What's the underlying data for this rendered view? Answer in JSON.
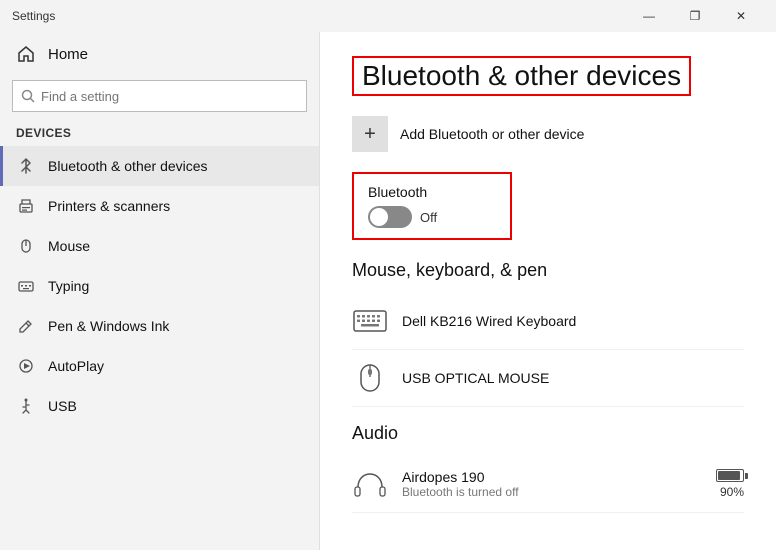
{
  "titleBar": {
    "title": "Settings",
    "minimize": "—",
    "maximize": "❐",
    "close": "✕"
  },
  "sidebar": {
    "home": "Home",
    "search": {
      "placeholder": "Find a setting"
    },
    "sectionLabel": "Devices",
    "items": [
      {
        "id": "bluetooth",
        "label": "Bluetooth & other devices",
        "active": true
      },
      {
        "id": "printers",
        "label": "Printers & scanners",
        "active": false
      },
      {
        "id": "mouse",
        "label": "Mouse",
        "active": false
      },
      {
        "id": "typing",
        "label": "Typing",
        "active": false
      },
      {
        "id": "pen",
        "label": "Pen & Windows Ink",
        "active": false
      },
      {
        "id": "autoplay",
        "label": "AutoPlay",
        "active": false
      },
      {
        "id": "usb",
        "label": "USB",
        "active": false
      }
    ]
  },
  "main": {
    "pageTitle": "Bluetooth & other devices",
    "addDevice": "Add Bluetooth or other device",
    "bluetooth": {
      "label": "Bluetooth",
      "state": "Off",
      "on": false
    },
    "sections": [
      {
        "title": "Mouse, keyboard, & pen",
        "devices": [
          {
            "name": "Dell KB216 Wired Keyboard",
            "status": "",
            "type": "keyboard"
          },
          {
            "name": "USB OPTICAL MOUSE",
            "status": "",
            "type": "mouse"
          }
        ]
      },
      {
        "title": "Audio",
        "devices": [
          {
            "name": "Airdopes 190",
            "status": "Bluetooth is turned off",
            "type": "headphones",
            "battery": 90
          }
        ]
      }
    ]
  }
}
